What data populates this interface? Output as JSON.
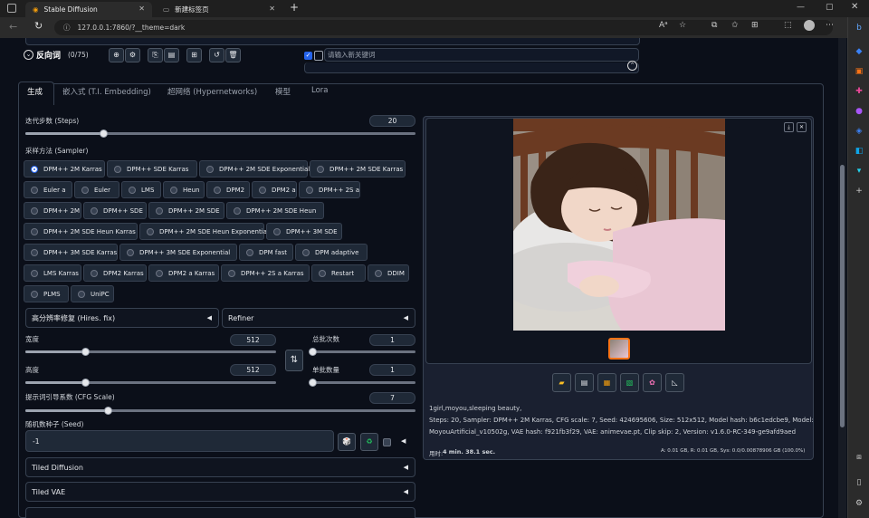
{
  "browser": {
    "tabs": [
      {
        "label": "Stable Diffusion",
        "active": true
      },
      {
        "label": "新建标签页",
        "active": false
      }
    ],
    "url": "127.0.0.1:7860/?__theme=dark"
  },
  "prompt_bar": {
    "title": "反向词",
    "count": "(0/75)",
    "add_keyword_placeholder": "请输入新关键词"
  },
  "main_tabs": [
    "生成",
    "嵌入式 (T.I. Embedding)",
    "超网络 (Hypernetworks)",
    "模型",
    "Lora"
  ],
  "steps": {
    "label": "迭代步数 (Steps)",
    "value": "20",
    "fraction": 0.2
  },
  "sampler": {
    "label": "采样方法 (Sampler)",
    "selected": "DPM++ 2M Karras",
    "options": [
      "DPM++ 2M Karras",
      "DPM++ SDE Karras",
      "DPM++ 2M SDE Exponential",
      "DPM++ 2M SDE Karras",
      "Euler a",
      "Euler",
      "LMS",
      "Heun",
      "DPM2",
      "DPM2 a",
      "DPM++ 2S a",
      "DPM++ 2M",
      "DPM++ SDE",
      "DPM++ 2M SDE",
      "DPM++ 2M SDE Heun",
      "DPM++ 2M SDE Heun Karras",
      "DPM++ 2M SDE Heun Exponential",
      "DPM++ 3M SDE",
      "DPM++ 3M SDE Karras",
      "DPM++ 3M SDE Exponential",
      "DPM fast",
      "DPM adaptive",
      "LMS Karras",
      "DPM2 Karras",
      "DPM2 a Karras",
      "DPM++ 2S a Karras",
      "Restart",
      "DDIM",
      "PLMS",
      "UniPC"
    ]
  },
  "hires": {
    "label": "高分辨率修复 (Hires. fix)"
  },
  "refiner": {
    "label": "Refiner"
  },
  "width": {
    "label": "宽度",
    "value": "512",
    "fraction": 0.24
  },
  "height": {
    "label": "高度",
    "value": "512",
    "fraction": 0.24
  },
  "batch_count": {
    "label": "总批次数",
    "value": "1",
    "fraction": 0.0
  },
  "batch_size": {
    "label": "单批数量",
    "value": "1",
    "fraction": 0.0
  },
  "cfg": {
    "label": "提示词引导系数 (CFG Scale)",
    "value": "7",
    "fraction": 0.21
  },
  "seed": {
    "label": "随机数种子 (Seed)",
    "value": "-1"
  },
  "accordions": [
    "Tiled Diffusion",
    "Tiled VAE"
  ],
  "output": {
    "info_line1": "1girl,moyou,sleeping beauty,",
    "info_line2": "Steps: 20, Sampler: DPM++ 2M Karras, CFG scale: 7, Seed: 424695606, Size: 512x512, Model hash: b6c1edcbe9, Model:",
    "info_line3": "MoyouArtificial_v10502g, VAE hash: f921fb3f29, VAE: animevae.pt, Clip skip: 2, Version: v1.6.0-RC-349-ge9afd9aed",
    "time_label": "用时:",
    "time_value": "4 min. 38.1 sec.",
    "memory": "A: 0.01 GB, R: 0.01 GB, Sys: 0.0/0.00878906 GB (100.0%)"
  },
  "icons": {
    "prompt_tools": [
      "globe-icon",
      "gear-icon",
      "paste-icon",
      "save-icon",
      "grid-icon",
      "refresh-icon",
      "trash-icon"
    ],
    "output_tools": [
      "folder-icon",
      "save-icon",
      "image-to-image-icon",
      "inpaint-icon",
      "palette-icon",
      "ruler-icon"
    ]
  },
  "colors": {
    "accent": "#2563eb",
    "background": "#0b0f19",
    "panel": "#1f2937",
    "recycle": "#22c55e"
  }
}
